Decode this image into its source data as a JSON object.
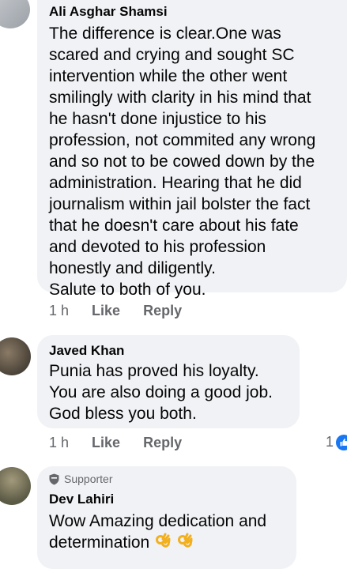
{
  "comments": [
    {
      "author": "Ali Asghar Shamsi",
      "lines": [
        "The difference is clear.One was",
        "scared and crying and sought SC",
        "intervention while the other went",
        "smilingly with clarity in his mind that",
        "he hasn't done injustice to his",
        "profession, not commited any wrong",
        "and so not to be cowed down by the",
        "administration. Hearing that he did",
        "journalism within jail bolster the fact",
        "that he doesn't care about his fate",
        "and devoted to his profession",
        "honestly and diligently.",
        "Salute to both of you."
      ],
      "time": "1 h",
      "like_label": "Like",
      "reply_label": "Reply"
    },
    {
      "author": "Javed Khan",
      "lines": [
        "Punia has proved his loyalty.",
        "You are also doing a good job.",
        "God bless you both."
      ],
      "time": "1 h",
      "like_label": "Like",
      "reply_label": "Reply",
      "reaction_count": "1",
      "reaction_icon": "like-reaction-icon"
    },
    {
      "badge": "Supporter",
      "badge_icon": "shield-badge-icon",
      "author": "Dev Lahiri",
      "lines": [
        "Wow Amazing dedication and",
        "determination"
      ],
      "emoji_icons": [
        "ok-hand-icon",
        "ok-hand-icon"
      ]
    }
  ],
  "colors": {
    "bubble": "#f0f2f5",
    "meta_text": "#65676b",
    "reaction_blue": "#1877f2"
  }
}
